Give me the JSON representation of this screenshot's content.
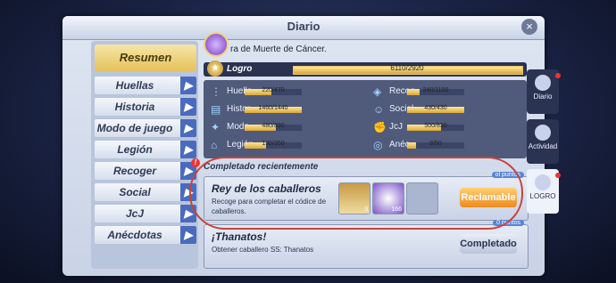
{
  "window": {
    "title": "Diario",
    "close_label": "×"
  },
  "header": {
    "text": "ra de Muerte de Cáncer."
  },
  "sidebar": {
    "active": "Resumen",
    "items": [
      {
        "label": "Huellas"
      },
      {
        "label": "Historia"
      },
      {
        "label": "Modo de juego"
      },
      {
        "label": "Legión"
      },
      {
        "label": "Recoger",
        "badge": "!"
      },
      {
        "label": "Social"
      },
      {
        "label": "JcJ"
      },
      {
        "label": "Anécdotas"
      }
    ]
  },
  "logro": {
    "label": "Logro",
    "value": "6110/2920",
    "progress": 1.0
  },
  "stats": [
    {
      "icon": "footprint-icon",
      "name": "Huella",
      "value": "220/470",
      "progress": 0.47
    },
    {
      "icon": "book-icon",
      "name": "Histor",
      "value": "1460/1440",
      "progress": 1.0
    },
    {
      "icon": "star-icon",
      "name": "Modo",
      "value": "480/890",
      "progress": 0.54
    },
    {
      "icon": "temple-icon",
      "name": "Legión",
      "value": "130/350",
      "progress": 0.37
    },
    {
      "icon": "collect-icon",
      "name": "Recog",
      "value": "240/1100",
      "progress": 0.22
    },
    {
      "icon": "social-icon",
      "name": "Social",
      "value": "430/430",
      "progress": 1.0
    },
    {
      "icon": "fist-icon",
      "name": "JcJ",
      "value": "500/830",
      "progress": 0.6
    },
    {
      "icon": "swirl-icon",
      "name": "Anéc",
      "value": "8/50",
      "progress": 0.16
    }
  ],
  "recent": {
    "title": "Completado recientemente"
  },
  "cards": [
    {
      "title": "Rey de los caballeros",
      "desc": "Recoge para completar el códice de caballeros.",
      "points": "ol puntos",
      "reward1_count": "3",
      "reward2_count": "166",
      "button": "Reclamable"
    },
    {
      "title": "¡Thanatos!",
      "desc": "Obtener caballero SS: Thanatos",
      "points": "0 puntos",
      "button": "Completado"
    }
  ],
  "right_tabs": [
    {
      "label": "Diario",
      "icon": "diary-icon"
    },
    {
      "label": "Actividad",
      "icon": "activity-icon"
    },
    {
      "label": "LOGRO",
      "icon": "trophy-icon",
      "active": true
    }
  ],
  "colors": {
    "accent": "#e5c25b",
    "panel": "#505a7a",
    "ring": "#c74339"
  }
}
